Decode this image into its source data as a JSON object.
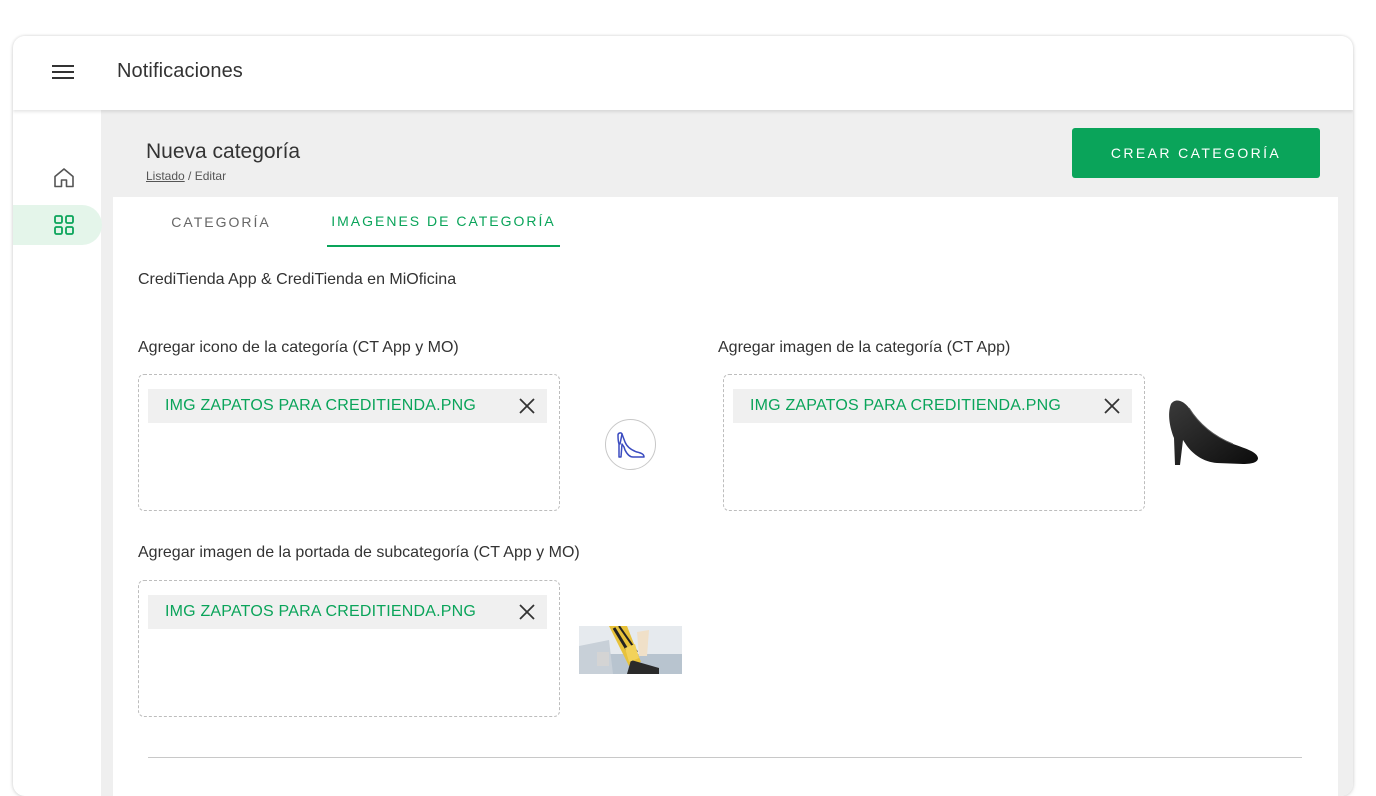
{
  "app": {
    "title": "Notificaciones"
  },
  "header": {
    "title": "Nueva categoría",
    "breadcrumb": {
      "link": "Listado",
      "separator": " / ",
      "current": "Editar"
    },
    "create_button": "CREAR CATEGORÍA"
  },
  "tabs": [
    {
      "label": "CATEGORÍA",
      "active": false
    },
    {
      "label": "IMAGENES DE CATEGORÍA",
      "active": true
    }
  ],
  "content": {
    "section_title": "CrediTienda App & CrediTienda en MiOficina",
    "uploads": {
      "icon": {
        "label": "Agregar icono de la categoría (CT App y MO)",
        "file_name": "IMG ZAPATOS PARA CREDITIENDA.PNG"
      },
      "image": {
        "label": "Agregar imagen de la categoría (CT App)",
        "file_name": "IMG ZAPATOS PARA CREDITIENDA.PNG"
      },
      "cover": {
        "label": "Agregar imagen de la portada de subcategoría (CT App y MO)",
        "file_name": "IMG ZAPATOS PARA CREDITIENDA.PNG"
      }
    }
  },
  "colors": {
    "accent": "#0aa45a",
    "active_nav_bg": "#e4f5ea",
    "page_bg": "#efefef",
    "chip_bg": "#f0f0f0",
    "icon_stroke": "#3b4cc0"
  },
  "icons": {
    "menu": "hamburger-menu-icon",
    "home": "home-icon",
    "grid": "grid-icon",
    "remove": "close-icon",
    "shoe": "high-heel-shoe-icon"
  }
}
